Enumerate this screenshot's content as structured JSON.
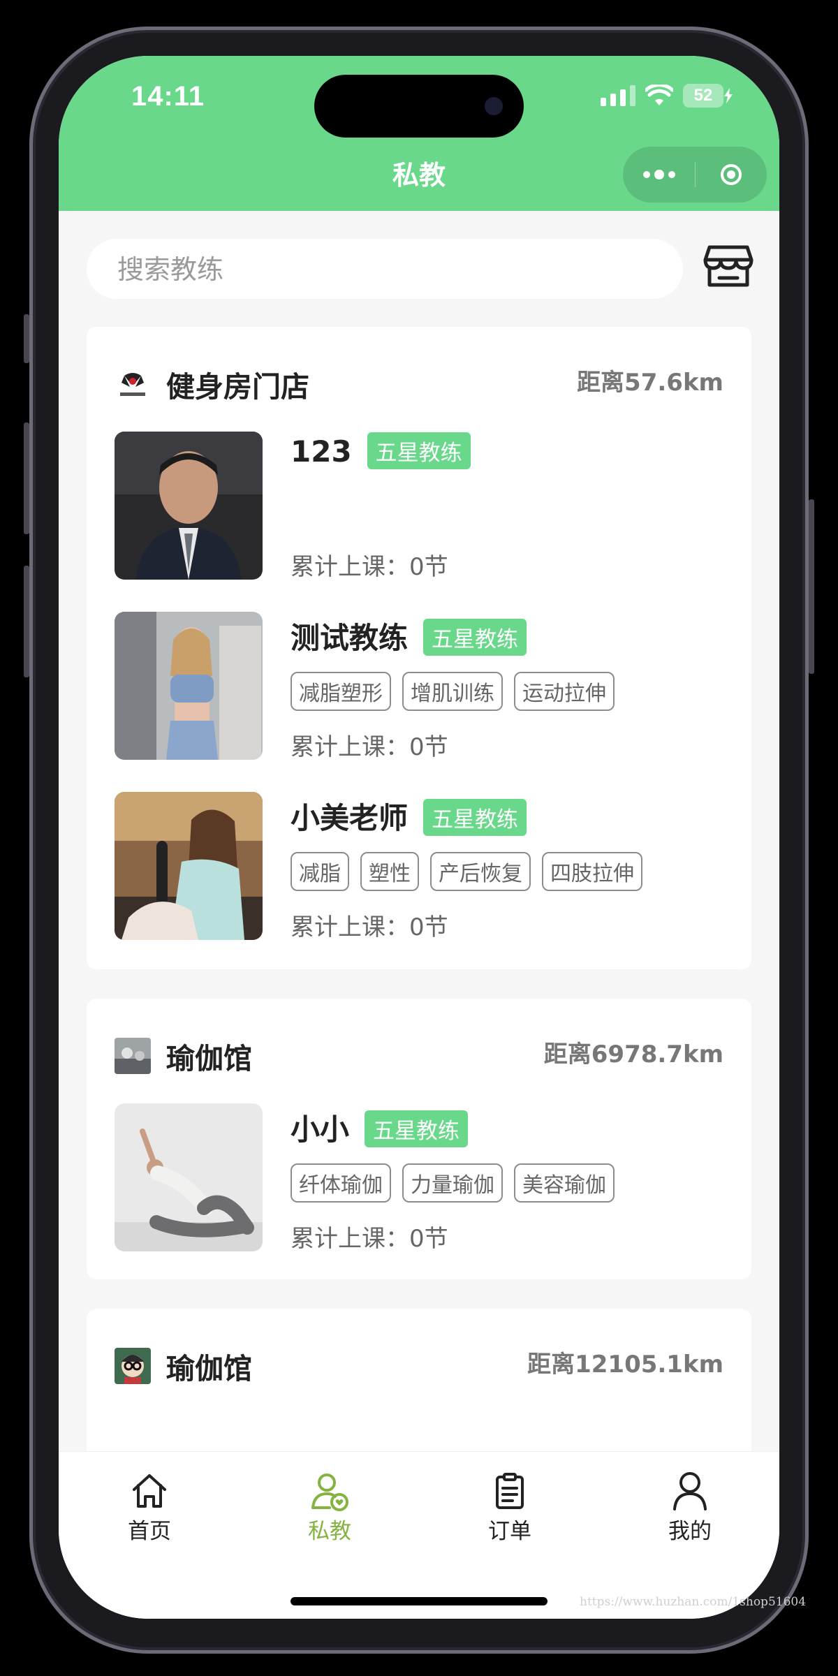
{
  "status": {
    "time": "14:11",
    "battery": "52"
  },
  "header": {
    "title": "私教"
  },
  "search": {
    "placeholder": "搜索教练"
  },
  "colors": {
    "accent": "#69d88b",
    "tab_active": "#84b33f"
  },
  "stores": [
    {
      "name": "健身房门店",
      "distance": "距离57.6km",
      "logo_icon": "replace-logo-icon",
      "coaches": [
        {
          "name": "123",
          "badge": "五星教练",
          "tags": [],
          "lessons": "累计上课：0节"
        },
        {
          "name": "测试教练",
          "badge": "五星教练",
          "tags": [
            "减脂塑形",
            "增肌训练",
            "运动拉伸"
          ],
          "lessons": "累计上课：0节"
        },
        {
          "name": "小美老师",
          "badge": "五星教练",
          "tags": [
            "减脂",
            "塑性",
            "产后恢复",
            "四肢拉伸"
          ],
          "lessons": "累计上课：0节"
        }
      ]
    },
    {
      "name": "瑜伽馆",
      "distance": "距离6978.7km",
      "coaches": [
        {
          "name": "小小",
          "badge": "五星教练",
          "tags": [
            "纤体瑜伽",
            "力量瑜伽",
            "美容瑜伽"
          ],
          "lessons": "累计上课：0节"
        }
      ]
    },
    {
      "name": "瑜伽馆",
      "distance": "距离12105.1km",
      "coaches": []
    }
  ],
  "tabbar": {
    "items": [
      {
        "label": "首页",
        "icon": "home-icon"
      },
      {
        "label": "私教",
        "icon": "coach-icon"
      },
      {
        "label": "订单",
        "icon": "order-icon"
      },
      {
        "label": "我的",
        "icon": "profile-icon"
      }
    ]
  },
  "watermark": "https://www.huzhan.com/1shop51604"
}
